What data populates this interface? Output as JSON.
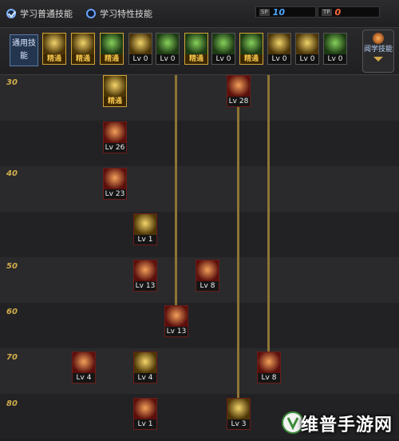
{
  "top": {
    "mode_normal": "学习普通技能",
    "mode_special": "学习特性技能",
    "sp_tag": "SP",
    "sp_value": "10",
    "tp_tag": "TP",
    "tp_value": "0"
  },
  "iconbar": {
    "common_label": "通用技能",
    "icons": [
      {
        "label": "精通",
        "mastered": true
      },
      {
        "label": "精通",
        "mastered": true
      },
      {
        "label": "精通",
        "mastered": true
      },
      {
        "label": "Lv 0",
        "mastered": false
      },
      {
        "label": "Lv 0",
        "mastered": false
      },
      {
        "label": "精通",
        "mastered": true
      },
      {
        "label": "Lv 0",
        "mastered": false
      },
      {
        "label": "精通",
        "mastered": true
      },
      {
        "label": "Lv 0",
        "mastered": false
      },
      {
        "label": "Lv 0",
        "mastered": false
      },
      {
        "label": "Lv 0",
        "mastered": false
      }
    ],
    "side_tag": "阅学技能"
  },
  "tree": {
    "levels": [
      "30",
      "40",
      "50",
      "60",
      "70",
      "80"
    ],
    "nodes": [
      {
        "label": "精通",
        "mastered": true
      },
      {
        "label": "Lv 28",
        "mastered": false
      },
      {
        "label": "Lv 26",
        "mastered": false
      },
      {
        "label": "Lv 23",
        "mastered": false
      },
      {
        "label": "Lv 1",
        "mastered": false
      },
      {
        "label": "Lv 13",
        "mastered": false
      },
      {
        "label": "Lv 8",
        "mastered": false
      },
      {
        "label": "Lv 13",
        "mastered": false
      },
      {
        "label": "Lv 4",
        "mastered": false
      },
      {
        "label": "Lv 4",
        "mastered": false
      },
      {
        "label": "Lv 8",
        "mastered": false
      },
      {
        "label": "Lv 1",
        "mastered": false
      },
      {
        "label": "Lv 3",
        "mastered": false
      }
    ]
  },
  "watermark": "维普手游网",
  "colors": {
    "accent_gold": "#d2ad4c",
    "sp_blue": "#4ea6ff",
    "tp_red": "#ff6a3a"
  }
}
